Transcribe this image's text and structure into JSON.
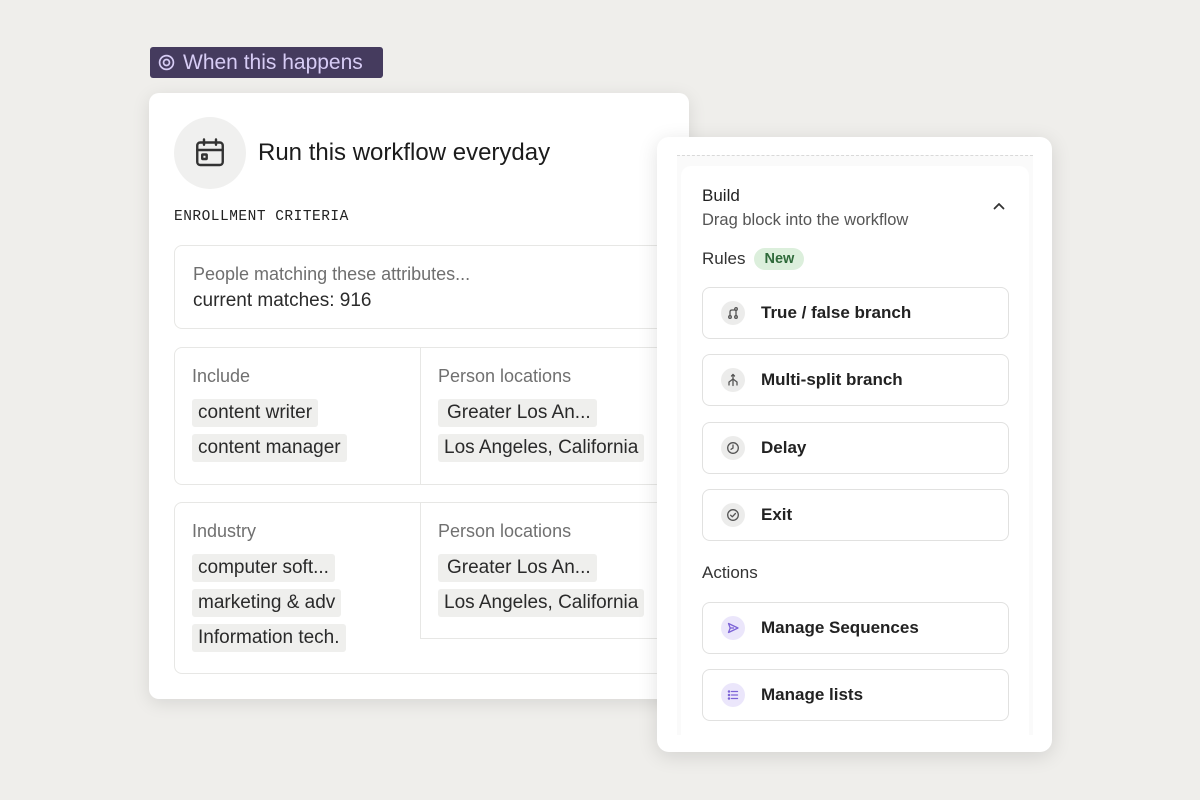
{
  "trigger": {
    "label": "When this happens"
  },
  "workflow": {
    "title": "Run this workflow everyday",
    "enrollment_label": "ENROLLMENT CRITERIA",
    "match_text": "People matching these attributes...",
    "current_matches": "current matches: 916",
    "criteria": [
      {
        "left_head": "Include",
        "left_chips": [
          "content writer",
          "content manager"
        ],
        "right_head": "Person locations",
        "right_chips": [
          "Greater Los An...",
          "Los Angeles, California"
        ]
      },
      {
        "left_head": "Industry",
        "left_chips": [
          "computer soft...",
          "marketing & adv",
          "Information tech."
        ],
        "right_head": "Person locations",
        "right_chips": [
          "Greater Los An...",
          "Los Angeles, California"
        ]
      }
    ]
  },
  "build": {
    "title": "Build",
    "subtitle": "Drag block into the workflow",
    "rules_label": "Rules",
    "new_badge": "New",
    "rules": [
      "True / false branch",
      "Multi-split branch",
      "Delay",
      "Exit"
    ],
    "actions_label": "Actions",
    "actions": [
      "Manage Sequences",
      "Manage lists"
    ]
  },
  "colors": {
    "trigger_bg": "#453b5e",
    "trigger_text": "#d7ccf5",
    "badge_bg": "#dcefdc",
    "accent_purple": "#7c63d6"
  },
  "icons": [
    "target-icon",
    "calendar-icon",
    "chevron-up-icon",
    "branch-icon",
    "split-icon",
    "clock-icon",
    "check-circle-icon",
    "send-icon",
    "list-icon"
  ]
}
